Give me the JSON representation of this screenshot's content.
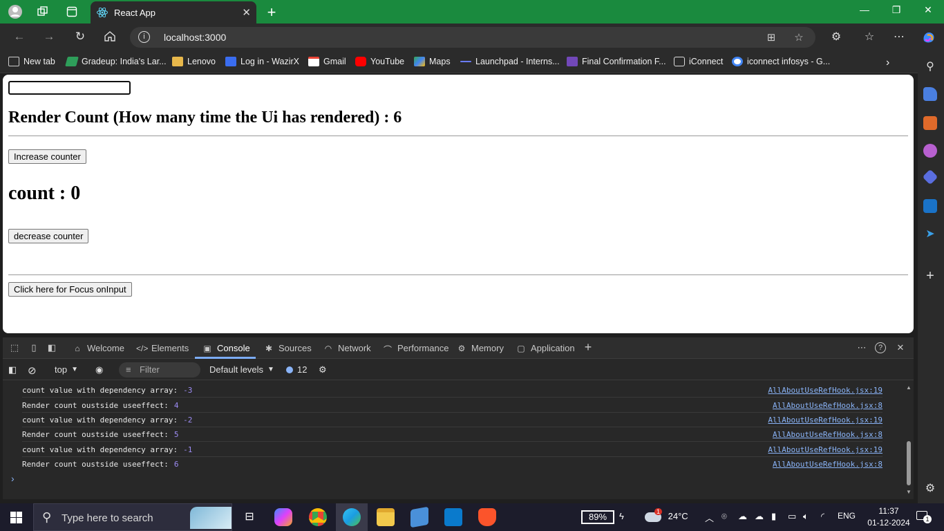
{
  "browser": {
    "tab_title": "React App",
    "url": "localhost:3000"
  },
  "bookmarks": [
    {
      "label": "New tab",
      "color": "#cccccc"
    },
    {
      "label": "Gradeup: India's Lar...",
      "color": "#2e9e5a"
    },
    {
      "label": "Lenovo",
      "color": "#e8b84b"
    },
    {
      "label": "Log in - WazirX",
      "color": "#3a6df0"
    },
    {
      "label": "Gmail",
      "color": "#ea4335"
    },
    {
      "label": "YouTube",
      "color": "#ff0000"
    },
    {
      "label": "Maps",
      "color": "#34a853"
    },
    {
      "label": "Launchpad - Interns...",
      "color": "#6a7cff"
    },
    {
      "label": "Final Confirmation F...",
      "color": "#7248b9"
    },
    {
      "label": "iConnect",
      "color": "#dddddd"
    },
    {
      "label": "iconnect infosys - G...",
      "color": "#ffffff"
    }
  ],
  "page": {
    "input_value": "",
    "render_heading": "Render Count (How many time the Ui has rendered) : 6",
    "increase_label": "Increase counter",
    "count_heading": "count : 0",
    "decrease_label": "decrease counter",
    "focus_label": "Click here for Focus onInput"
  },
  "devtools": {
    "tabs": [
      {
        "label": "Welcome"
      },
      {
        "label": "Elements"
      },
      {
        "label": "Console"
      },
      {
        "label": "Sources"
      },
      {
        "label": "Network"
      },
      {
        "label": "Performance"
      },
      {
        "label": "Memory"
      },
      {
        "label": "Application"
      }
    ],
    "context": "top",
    "filter_placeholder": "Filter",
    "levels": "Default levels",
    "issues_count": "12",
    "logs": [
      {
        "text": "count value with dependency array:",
        "value": "-3",
        "source": "AllAboutUseRefHook.jsx:19"
      },
      {
        "text": "Render count oustside useeffect:",
        "value": "4",
        "source": "AllAboutUseRefHook.jsx:8"
      },
      {
        "text": "count value with dependency array:",
        "value": "-2",
        "source": "AllAboutUseRefHook.jsx:19"
      },
      {
        "text": "Render count oustside useeffect:",
        "value": "5",
        "source": "AllAboutUseRefHook.jsx:8"
      },
      {
        "text": "count value with dependency array:",
        "value": "-1",
        "source": "AllAboutUseRefHook.jsx:19"
      },
      {
        "text": "Render count oustside useeffect:",
        "value": "6",
        "source": "AllAboutUseRefHook.jsx:8"
      }
    ]
  },
  "taskbar": {
    "search_placeholder": "Type here to search",
    "battery": "89%",
    "weather": "24°C",
    "weather_badge": "1",
    "language": "ENG",
    "time": "11:37",
    "date": "01-12-2024",
    "notifications": "1"
  }
}
